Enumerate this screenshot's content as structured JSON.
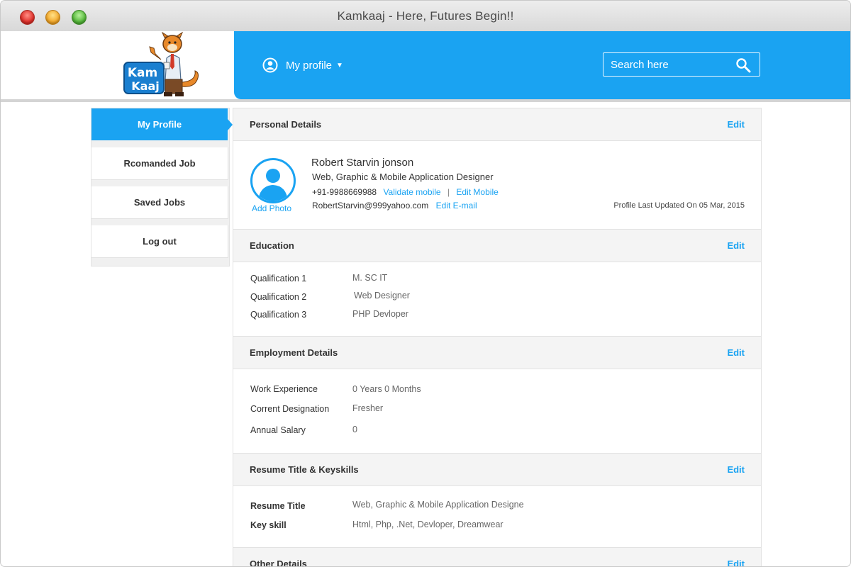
{
  "window": {
    "title": "Kamkaaj - Here, Futures Begin!!"
  },
  "logo": {
    "text_top": "Kam",
    "text_bottom": "Kaaj"
  },
  "header": {
    "profile_menu_label": "My profile",
    "search_placeholder": "Search here"
  },
  "sidebar": {
    "items": [
      {
        "label": "My Profile",
        "active": true
      },
      {
        "label": "Rcomanded Job"
      },
      {
        "label": "Saved Jobs"
      },
      {
        "label": "Log out"
      }
    ]
  },
  "sections": {
    "personal": {
      "title": "Personal Details",
      "edit": "Edit",
      "add_photo": "Add Photo",
      "name": "Robert Starvin jonson",
      "designation": "Web, Graphic & Mobile Application Designer",
      "phone": "+91-9988669988",
      "validate_mobile": "Validate mobile",
      "separator": "|",
      "edit_mobile": "Edit Mobile",
      "email": "RobertStarvin@999yahoo.com",
      "edit_email": "Edit E-mail",
      "last_updated": "Profile Last Updated On 05 Mar, 2015"
    },
    "education": {
      "title": "Education",
      "edit": "Edit",
      "rows": [
        {
          "label": "Qualification 1",
          "value": "M. SC IT"
        },
        {
          "label": "Qualification 2",
          "value": "Web Designer"
        },
        {
          "label": "Qualification 3",
          "value": "PHP Devloper"
        }
      ]
    },
    "employment": {
      "title": "Employment Details",
      "edit": "Edit",
      "rows": [
        {
          "label": "Work Experience",
          "value": "0 Years 0 Months"
        },
        {
          "label": "Corrent Designation",
          "value": "Fresher"
        },
        {
          "label": "Annual Salary",
          "value": "0"
        }
      ]
    },
    "resume": {
      "title": "Resume Title & Keyskills",
      "edit": "Edit",
      "rows": [
        {
          "label": "Resume Title",
          "value": "Web, Graphic & Mobile Application Designe"
        },
        {
          "label": "Key skill",
          "value": "Html, Php, .Net, Devloper, Dreamwear"
        }
      ]
    },
    "other": {
      "title": "Other Details",
      "edit": "Edit"
    }
  },
  "colors": {
    "accent": "#1aa3f2"
  }
}
